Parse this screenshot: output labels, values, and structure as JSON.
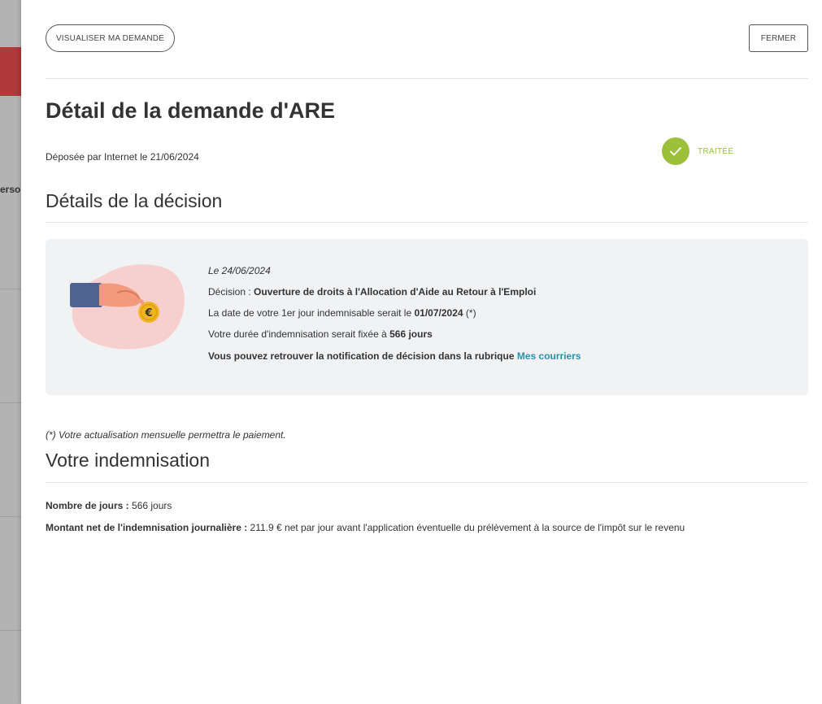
{
  "background": {
    "partial_text": "ersoi"
  },
  "panel": {
    "view_request_button": "VISUALISER MA DEMANDE",
    "close_button": "FERMER",
    "title": "Détail de la demande d'ARE",
    "deposit_text": "Déposée par Internet le 21/06/2024",
    "status": {
      "label": "TRAITÉE",
      "color": "#9dc03a",
      "icon": "check-icon"
    },
    "decision_section": {
      "heading": "Détails de la décision",
      "date": "Le 24/06/2024",
      "decision_label": "Décision :",
      "decision_value": "Ouverture de droits à l'Allocation d'Aide au Retour à l'Emploi",
      "first_day_text": "La date de votre 1er jour indemnisable serait le",
      "first_day_date": "01/07/2024",
      "first_day_suffix": "(*)",
      "duration_text": "Votre durée d'indemnisation serait fixée à",
      "duration_value": "566 jours",
      "notification_text": "Vous pouvez retrouver la notification de décision dans la rubrique",
      "notification_link": "Mes courriers",
      "illustration": "hand-coin-euro-illustration"
    },
    "footnote": "(*) Votre actualisation mensuelle permettra le paiement.",
    "indemnisation_section": {
      "heading": "Votre indemnisation",
      "days_label": "Nombre de jours :",
      "days_value": "566 jours",
      "amount_label": "Montant net de l'indemnisation journalière :",
      "amount_value": "211.9 € net par jour avant l'application éventuelle du prélèvement à la source de l'impôt sur le revenu"
    }
  },
  "colors": {
    "accent_link": "#2e8fa8",
    "status_green": "#9dc03a",
    "card_background": "#f1f2f4",
    "background_red": "#b0393a"
  }
}
